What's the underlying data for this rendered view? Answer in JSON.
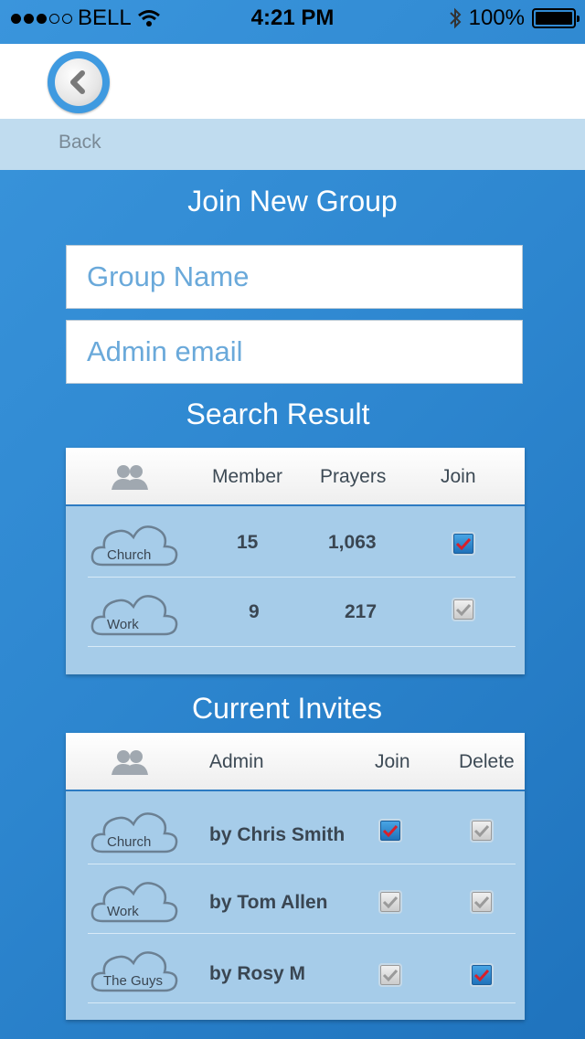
{
  "status_bar": {
    "carrier": "BELL",
    "time": "4:21 PM",
    "battery": "100%"
  },
  "nav": {
    "back_label": "Back"
  },
  "join_group": {
    "title": "Join New Group",
    "group_name_placeholder": "Group Name",
    "admin_email_placeholder": "Admin email"
  },
  "search_result": {
    "title": "Search Result",
    "headers": {
      "member": "Member",
      "prayers": "Prayers",
      "join": "Join"
    },
    "rows": [
      {
        "group": "Church",
        "member": "15",
        "prayers": "1,063",
        "join_checked": true
      },
      {
        "group": "Work",
        "member": "9",
        "prayers": "217",
        "join_checked": false
      }
    ]
  },
  "current_invites": {
    "title": "Current Invites",
    "headers": {
      "admin": "Admin",
      "join": "Join",
      "delete": "Delete"
    },
    "rows": [
      {
        "group": "Church",
        "admin": "by Chris Smith",
        "join_checked": true,
        "delete_checked": false
      },
      {
        "group": "Work",
        "admin": "by Tom Allen",
        "join_checked": false,
        "delete_checked": false
      },
      {
        "group": "The Guys",
        "admin": "by Rosy M",
        "join_checked": false,
        "delete_checked": true
      }
    ]
  },
  "colors": {
    "background": "#2d86cf",
    "check_mark": "#d8202a",
    "input_placeholder": "#6aa9da"
  }
}
